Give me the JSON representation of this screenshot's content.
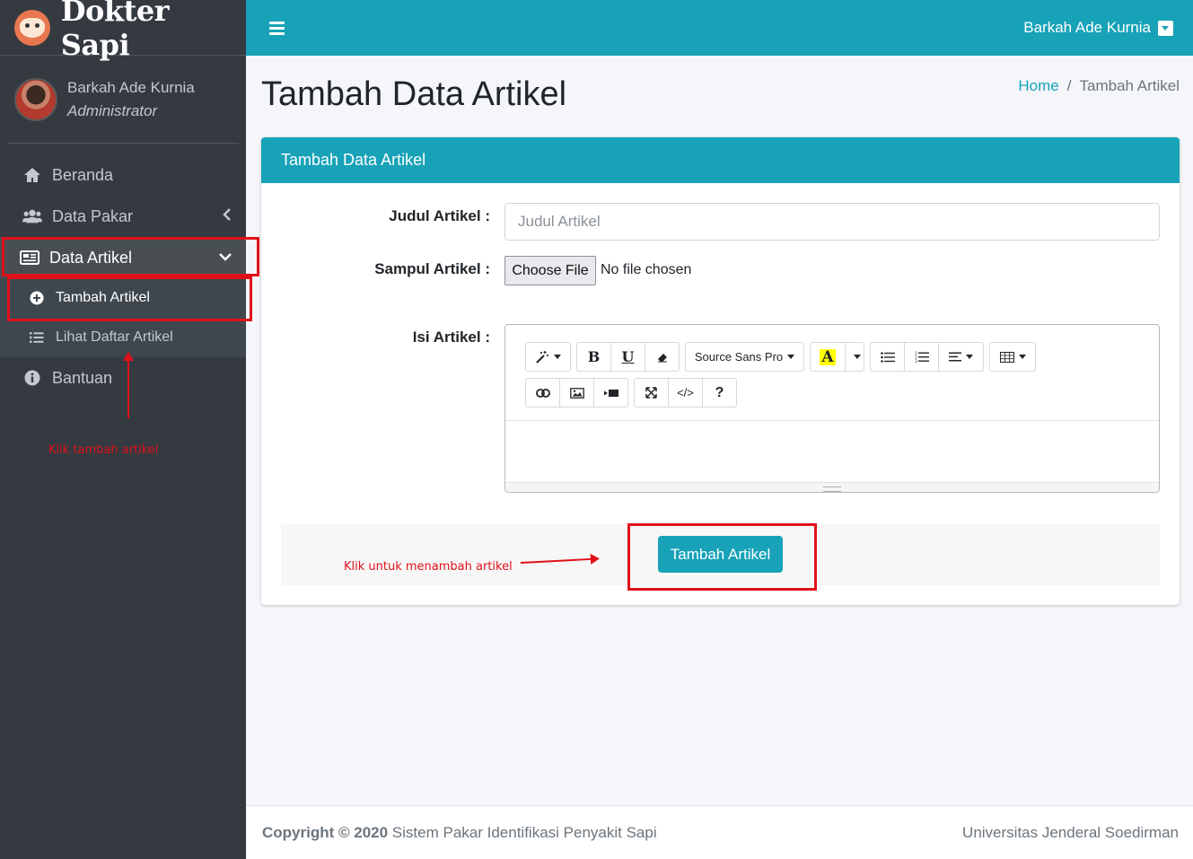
{
  "brand": {
    "name": "Dokter Sapi",
    "icon": "cow-icon"
  },
  "sidebar": {
    "user": {
      "name": "Barkah Ade Kurnia",
      "role": "Administrator"
    },
    "items": [
      {
        "label": "Beranda",
        "icon": "home-icon"
      },
      {
        "label": "Data Pakar",
        "icon": "users-icon"
      },
      {
        "label": "Data Artikel",
        "icon": "newspaper-icon",
        "active": true,
        "children": [
          {
            "label": "Tambah Artikel",
            "icon": "plus-circle-icon",
            "active": true
          },
          {
            "label": "Lihat Daftar Artikel",
            "icon": "list-icon"
          }
        ]
      },
      {
        "label": "Bantuan",
        "icon": "info-circle-icon"
      }
    ],
    "annotation": "Klik tambah artikel"
  },
  "topbar": {
    "user_name": "Barkah Ade Kurnia"
  },
  "page": {
    "title": "Tambah Data Artikel",
    "breadcrumb": {
      "home": "Home",
      "separator": "/",
      "current": "Tambah Artikel"
    }
  },
  "card": {
    "header": "Tambah Data Artikel",
    "fields": {
      "judul_label": "Judul Artikel :",
      "judul_placeholder": "Judul Artikel",
      "judul_value": "",
      "sampul_label": "Sampul Artikel :",
      "file_button": "Choose File",
      "file_status": "No file chosen",
      "isi_label": "Isi Artikel :"
    },
    "editor": {
      "font_name": "Source Sans Pro",
      "color_letter": "A",
      "bold": "B",
      "underline": "U",
      "code": "</>",
      "help": "?"
    },
    "submit_label": "Tambah Artikel",
    "annotation": "Klik untuk menambah artikel"
  },
  "footer": {
    "copyright_prefix": "Copyright © 2020",
    "copyright_text": "Sistem Pakar Identifikasi Penyakit Sapi",
    "right": "Universitas Jenderal Soedirman"
  },
  "colors": {
    "accent": "#17a2b8",
    "sidebar": "#343a40",
    "annotation": "#e0101a"
  }
}
